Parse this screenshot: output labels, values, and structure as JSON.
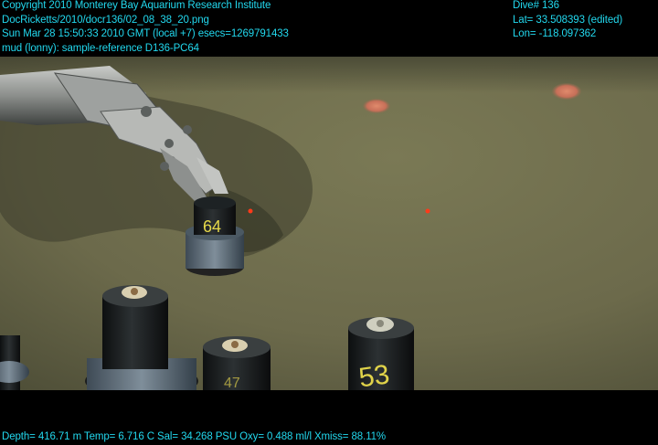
{
  "header": {
    "copyright": "Copyright 2010 Monterey Bay Aquarium Research Institute",
    "file_path": "DocRicketts/2010/docr136/02_08_38_20.png",
    "timestamp": "Sun Mar 28 15:50:33 2010 GMT (local +7)  esecs=1269791433",
    "annotation": "mud (lonny): sample-reference D136-PC64",
    "dive": "Dive# 136",
    "lat": "Lat= 33.508393 (edited)",
    "lon": "Lon= -118.097362"
  },
  "footer": {
    "telemetry": "Depth= 416.71 m  Temp= 6.716 C  Sal= 34.268 PSU  Oxy= 0.488 ml/l  Xmiss= 88.11%"
  },
  "scene": {
    "core_labels": {
      "held_core": "64",
      "right_core": "53",
      "center_core": "47"
    }
  },
  "colors": {
    "overlay_text": "#22d8ee",
    "seafloor": "#6f6e4e",
    "laser_dot": "#ff3a1a"
  }
}
